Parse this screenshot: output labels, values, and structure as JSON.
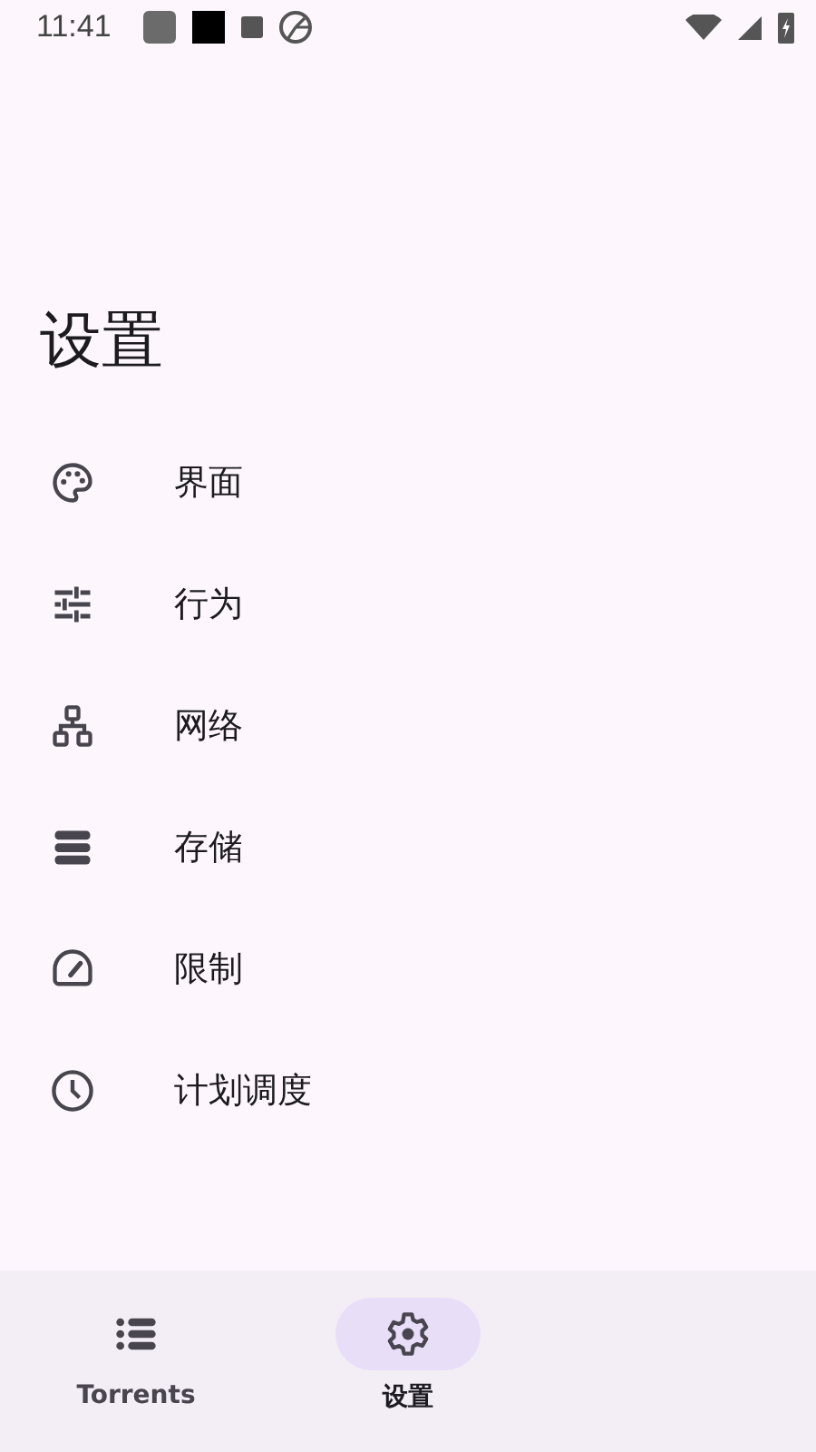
{
  "status_bar": {
    "time": "11:41"
  },
  "title": "设置",
  "items": [
    {
      "label": "界面",
      "kind": "palette"
    },
    {
      "label": "行为",
      "kind": "tune"
    },
    {
      "label": "网络",
      "kind": "network"
    },
    {
      "label": "存储",
      "kind": "storage"
    },
    {
      "label": "限制",
      "kind": "speed"
    },
    {
      "label": "计划调度",
      "kind": "clock"
    }
  ],
  "nav": [
    {
      "label": "Torrents",
      "kind": "list",
      "selected": false
    },
    {
      "label": "设置",
      "kind": "gear",
      "selected": true
    }
  ]
}
